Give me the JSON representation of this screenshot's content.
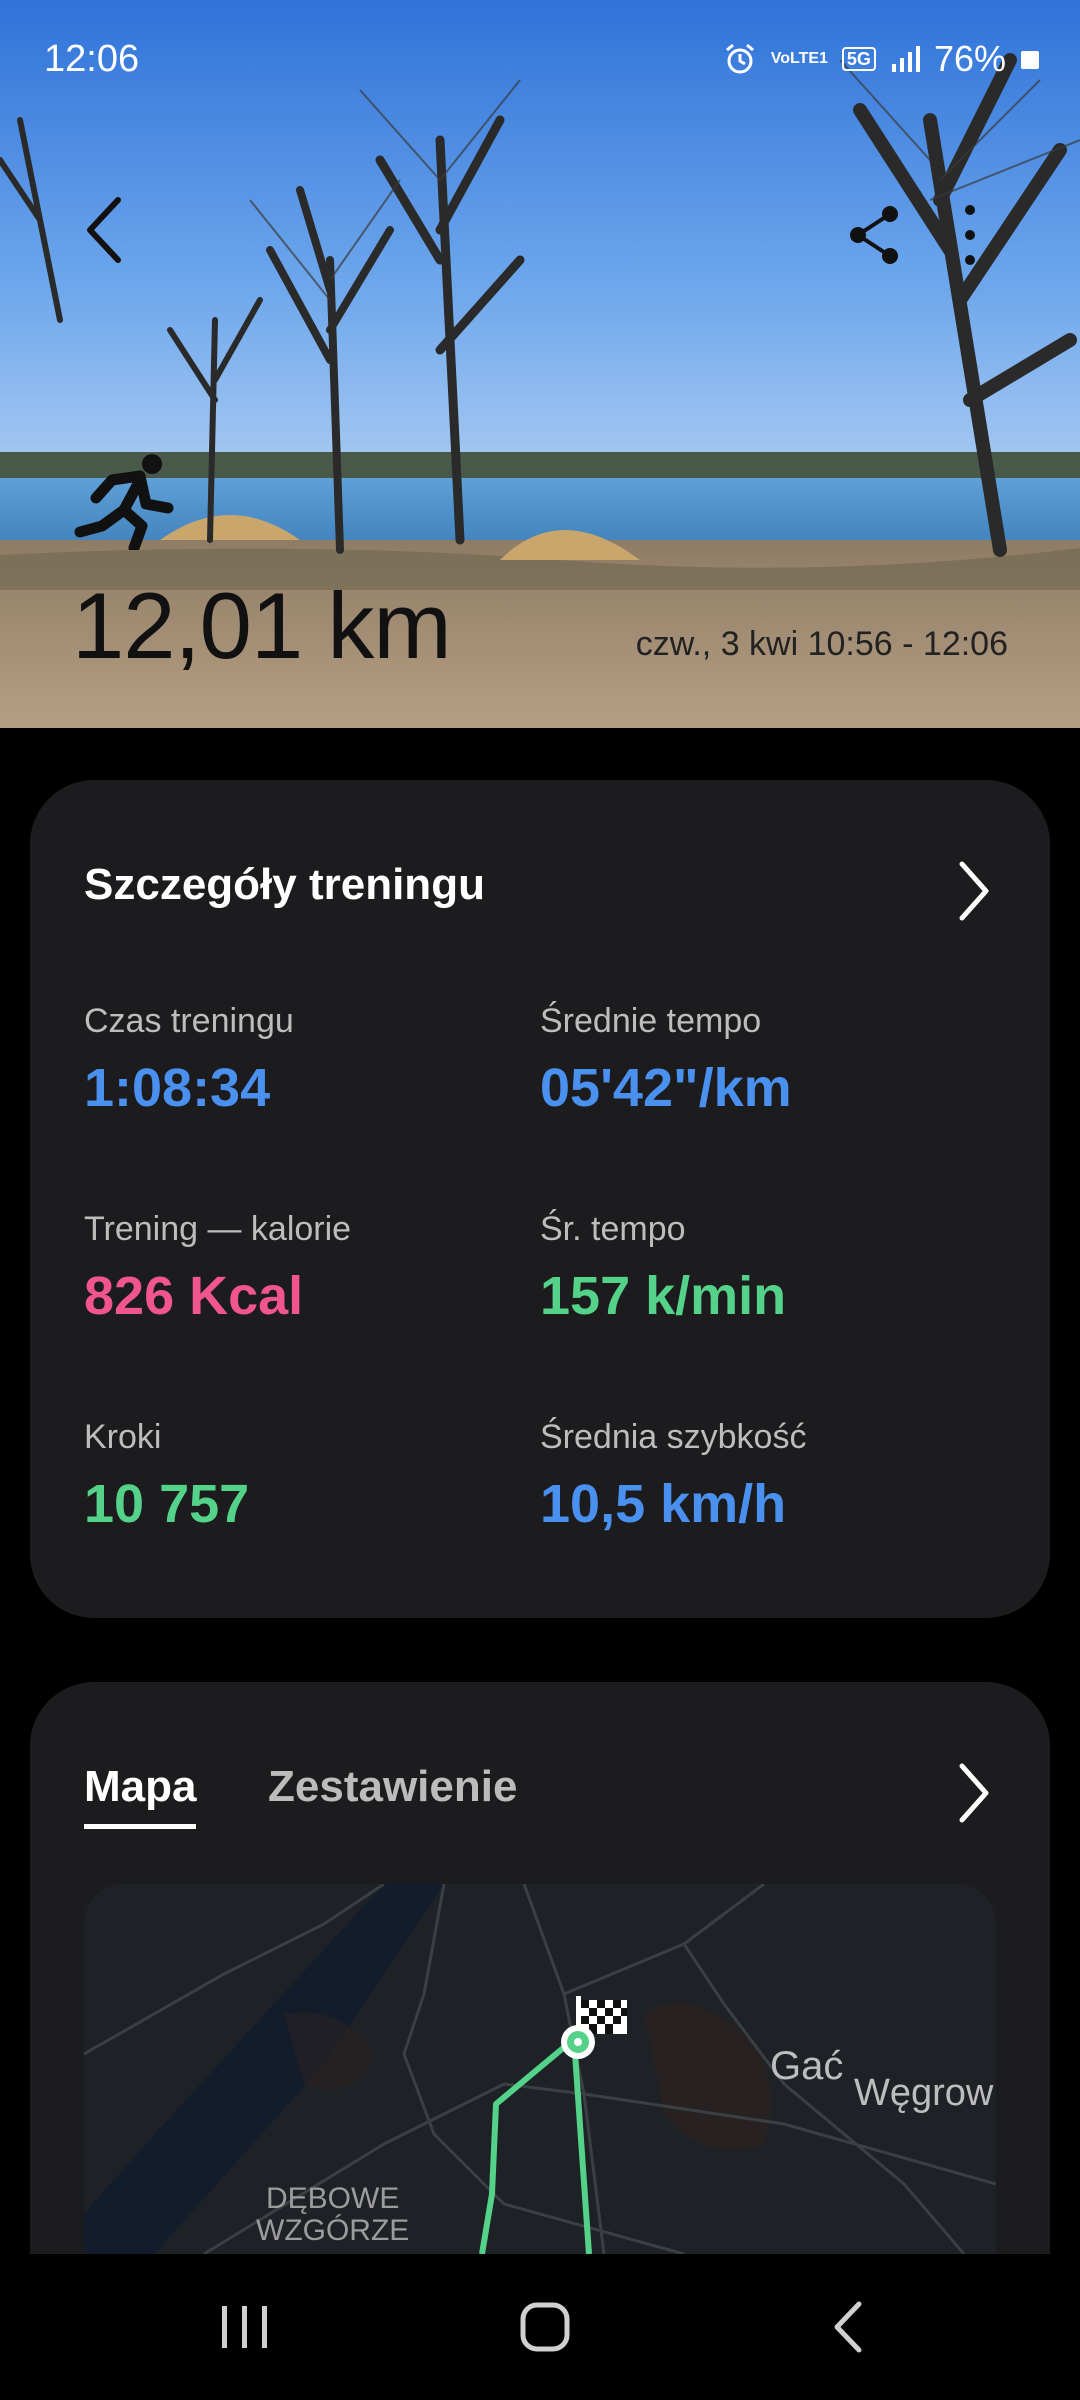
{
  "status_bar": {
    "time": "12:06",
    "battery": "76%",
    "icons": [
      "alarm-icon",
      "volte-icon",
      "5g-icon",
      "signal-icon",
      "battery-icon"
    ],
    "volte_label": "VoLTE1",
    "network": "5G"
  },
  "hero": {
    "distance": "12,01 km",
    "datetime": "czw., 3 kwi 10:56 - 12:06",
    "activity_icon": "running-icon"
  },
  "details": {
    "title": "Szczegóły treningu",
    "stats": [
      {
        "label": "Czas treningu",
        "value": "1:08:34",
        "color": "#4a90ef"
      },
      {
        "label": "Średnie tempo",
        "value": "05'42\"/km",
        "color": "#4a90ef"
      },
      {
        "label": "Trening — kalorie",
        "value": "826 Kcal",
        "color": "#f0568c"
      },
      {
        "label": "Śr. tempo",
        "value": "157 k/min",
        "color": "#55d289"
      },
      {
        "label": "Kroki",
        "value": "10 757",
        "color": "#55d289"
      },
      {
        "label": "Średnia szybkość",
        "value": "10,5 km/h",
        "color": "#4a90ef"
      }
    ]
  },
  "map_section": {
    "tabs": [
      {
        "label": "Mapa",
        "selected": true
      },
      {
        "label": "Zestawienie",
        "selected": false
      }
    ],
    "place_labels": [
      "Gać",
      "Węgrow",
      "DĘBOWE",
      "WZGÓRZE"
    ]
  },
  "colors": {
    "accent_blue": "#4a90ef",
    "accent_pink": "#f0568c",
    "accent_green": "#55d289",
    "card_bg": "#1c1c1e"
  }
}
